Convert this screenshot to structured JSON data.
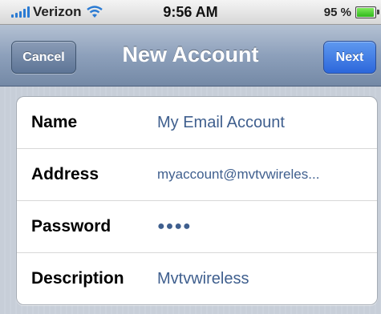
{
  "status_bar": {
    "carrier": "Verizon",
    "time": "9:56 AM",
    "battery": "95 %",
    "battery_level": 0.95,
    "icons": [
      "signal-icon",
      "wifi-icon",
      "battery-icon"
    ]
  },
  "nav": {
    "title": "New Account",
    "cancel_label": "Cancel",
    "next_label": "Next"
  },
  "form": {
    "rows": [
      {
        "label": "Name",
        "value": "My Email Account"
      },
      {
        "label": "Address",
        "value": "myaccount@mvtvwireles..."
      },
      {
        "label": "Password",
        "value": "●●●●"
      },
      {
        "label": "Description",
        "value": "Mvtvwireless"
      }
    ]
  },
  "colors": {
    "accent_blue": "#2c67db",
    "value_text": "#3f5f8e",
    "nav_bar": "#8da0bb"
  }
}
